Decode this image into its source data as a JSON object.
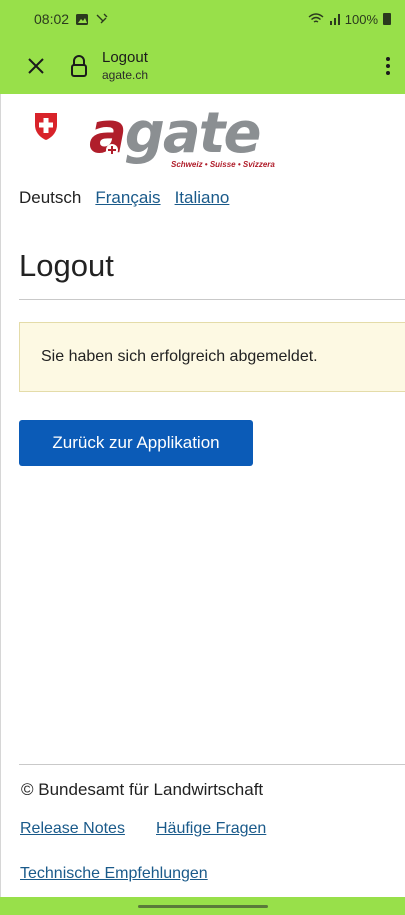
{
  "status_bar": {
    "time": "08:02",
    "battery": "100%"
  },
  "browser": {
    "page_title": "Logout",
    "domain": "agate.ch"
  },
  "logo": {
    "brand_a": "a",
    "brand_rest": "gate",
    "tagline": "Schweiz • Suisse • Svizzera"
  },
  "languages": {
    "current": "Deutsch",
    "links": [
      "Français",
      "Italiano"
    ]
  },
  "main": {
    "title": "Logout",
    "message": "Sie haben sich erfolgreich abgemeldet.",
    "back_button": "Zurück zur Applikation"
  },
  "footer": {
    "copyright": "© Bundesamt für Landwirtschaft",
    "links": [
      "Release Notes",
      "Häufige Fragen",
      "Technische Empfehlungen"
    ]
  },
  "colors": {
    "browser_bar": "#98e04a",
    "brand_red": "#b01e2b",
    "link_blue": "#1a5a8a",
    "button_blue": "#0b5bb7",
    "alert_bg": "#fdf9e3"
  }
}
